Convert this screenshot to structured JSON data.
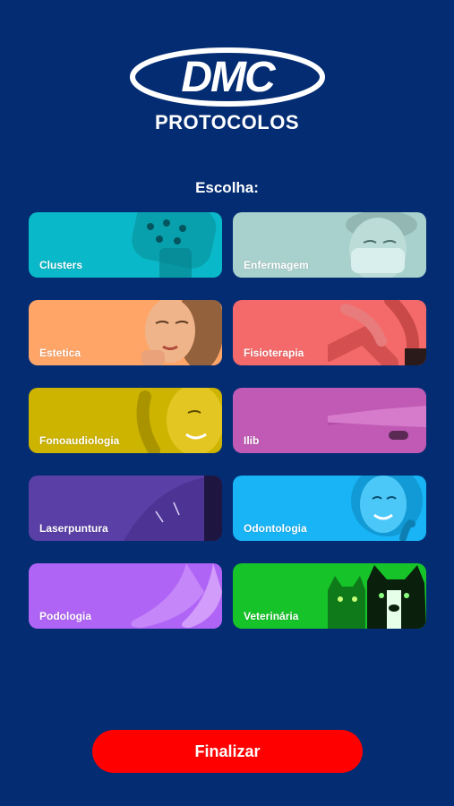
{
  "brand": {
    "logo_text": "DMC",
    "subtitle": "PROTOCOLOS"
  },
  "prompt": "Escolha:",
  "cards": [
    {
      "label": "Clusters",
      "color": "#0ab9c9",
      "icon": "device-applicator-icon"
    },
    {
      "label": "Enfermagem",
      "color": "#a8d0cc",
      "icon": "nurse-mask-icon"
    },
    {
      "label": "Estetica",
      "color": "#ffa567",
      "icon": "face-portrait-icon"
    },
    {
      "label": "Fisioterapia",
      "color": "#f46a6a",
      "icon": "knee-therapy-icon"
    },
    {
      "label": "Fonoaudiologia",
      "color": "#cdb400",
      "icon": "ear-listening-icon"
    },
    {
      "label": "Ilib",
      "color": "#c05ab4",
      "icon": "wrist-laser-icon"
    },
    {
      "label": "Laserpuntura",
      "color": "#5a3fa6",
      "icon": "acupuncture-back-icon"
    },
    {
      "label": "Odontologia",
      "color": "#18b4f6",
      "icon": "smile-portrait-icon"
    },
    {
      "label": "Podologia",
      "color": "#b064f6",
      "icon": "feet-icon"
    },
    {
      "label": "Veterinária",
      "color": "#16c429",
      "icon": "cat-dog-icon"
    }
  ],
  "finish_label": "Finalizar",
  "colors": {
    "background": "#032c73",
    "button": "#fe0000"
  }
}
